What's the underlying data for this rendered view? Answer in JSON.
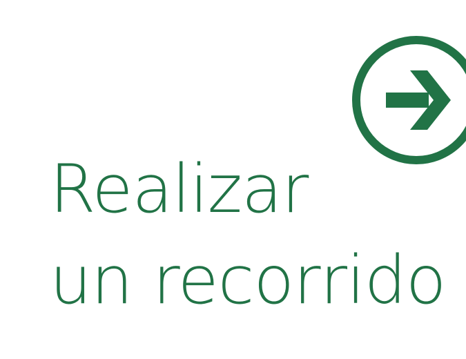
{
  "tour": {
    "line1": "Realizar",
    "line2": "un recorrido",
    "icon": "arrow-right-circle-icon",
    "accent_color": "#217346"
  }
}
